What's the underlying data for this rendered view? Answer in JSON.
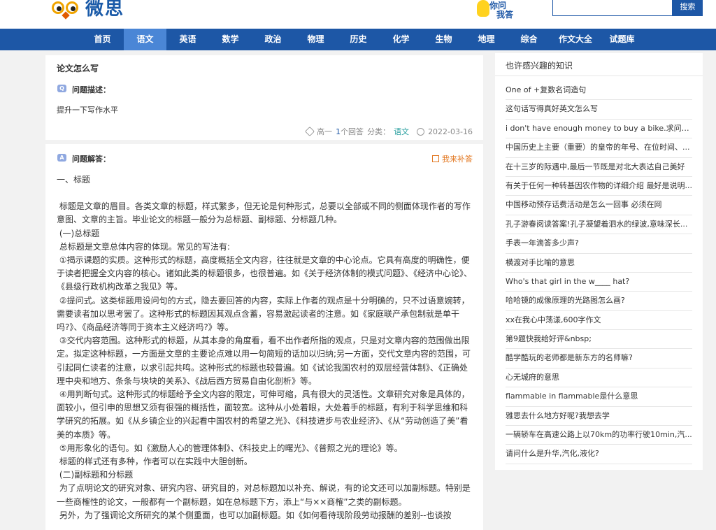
{
  "header": {
    "logo_text": "微思",
    "ask_badge": {
      "line1": "你问",
      "line2": "我答"
    },
    "search": {
      "placeholder": "",
      "button_label": "搜索"
    }
  },
  "nav": {
    "items": [
      "首页",
      "语文",
      "英语",
      "数学",
      "政治",
      "物理",
      "历史",
      "化学",
      "生物",
      "地理",
      "综合",
      "作文大全",
      "试题库"
    ],
    "active": "语文"
  },
  "question": {
    "title": "论文怎么写",
    "desc_tag": "Q",
    "desc_label": "问题描述：",
    "desc": "提升一下写作水平",
    "grade": "高一",
    "answer_count_num": "1",
    "answer_count_suffix": "个回答",
    "category_label": "分类：",
    "category": "语文",
    "date": "2022-03-16"
  },
  "answer": {
    "tag": "A",
    "label": "问题解答：",
    "supplement": "我来补答",
    "paragraphs": [
      "一、标题",
      "",
      " 标题是文章的眉目。各类文章的标题，样式繁多，但无论是何种形式，总要以全部或不同的侧面体现作者的写作意图、文章的主旨。毕业论文的标题一般分为总标题、副标题、分标题几种。",
      " (一)总标题",
      " 总标题是文章总体内容的体现。常见的写法有:",
      " ①揭示课题的实质。这种形式的标题，高度概括全文内容，往往就是文章的中心论点。它具有高度的明确性，便于读者把握全文内容的核心。诸如此类的标题很多，也很普遍。如《关于经济体制的模式问题》、《经济中心论》、《县级行政机构改革之我见》等。",
      " ②提问式。这类标题用设问句的方式，隐去要回答的内容，实际上作者的观点是十分明确的，只不过语意婉转，需要读者加以思考罢了。这种形式的标题因其观点含蓄，容易激起读者的注意。如《家庭联产承包制就是单干吗?》、《商品经济等同于资本主义经济吗?》等。",
      " ③交代内容范围。这种形式的标题，从其本身的角度看，看不出作者所指的观点，只是对文章内容的范围做出限定。拟定这种标题，一方面是文章的主要论点难以用一句简短的话加以归纳;另一方面，交代文章内容的范围，可引起同仁读者的注意，以求引起共鸣。这种形式的标题也较普遍。如《试论我国农村的双层经营体制》、《正确处理中央和地方、条条与块块的关系》、《战后西方贸易自由化剖析》等。",
      " ④用判断句式。这种形式的标题给予全文内容的限定，可伸可缩，具有很大的灵活性。文章研究对象是具体的，面较小，但引申的思想又须有很强的概括性，面较宽。这种从小处着眼，大处着手的标题，有利于科学思维和科学研究的拓展。如《从乡镇企业的兴起看中国农村的希望之光》、《科技进步与农业经济》、《从“劳动创造了美”看美的本质》等。",
      " ⑤用形象化的语句。如《激励人心的管理体制》、《科技史上的曙光》、《普照之光的理论》等。",
      " 标题的样式还有多种，作者可以在实践中大胆创新。",
      " (二)副标题和分标题",
      " 为了点明论文的研究对象、研究内容、研究目的，对总标题加以补充、解说，有的论文还可以加副标题。特别是一些商榷性的论文，一般都有一个副标题，如在总标题下方，添上“与××商榷”之类的副标题。",
      " 另外，为了强调论文所研究的某个侧重面，也可以加副标题。如《如何看待现阶段劳动报酬的差别--也谈按"
    ]
  },
  "sidebar": {
    "title": "也许感兴趣的知识",
    "items": [
      "One of +复数名词造句",
      "这句话写得真好英文怎么写",
      "i don't have enough money to buy a bike.求问句!",
      "中国历史上主要（重要）的皇帝的年号、在位时间、...",
      "在十三岁的际遇中,最后一节既是对北大表达自己美好",
      "有关于任何一种转基因农作物的详细介绍 最好是说明...",
      "中国移动预存话费活动是怎么一回事 必须在网",
      "孔子游春阅读答案!孔子凝望着泗水的绿波,意味深长...",
      "手表一年滴答多少声?",
      "横渡对手比喻的意思",
      "Who's that girl in the w____ hat?",
      "哈哈镜的成像原理的光路图怎么画?",
      "xx在我心中荡漾,600字作文",
      "第9题快我给好评&nbsp;",
      "酷学酷玩的老师都是新东方的名师嘛?",
      "心无城府的意思",
      "flammable in flammable是什么意思",
      "雅思去什么地方好呢?我想去学",
      "一辆轿车在高速公路上以70km的功率行驶10min,汽...",
      "请问什么是升华,汽化,液化?"
    ]
  },
  "colors": {
    "brand": "#1d57a6",
    "nav_active": "#4a86d6",
    "accent": "#e2761e"
  }
}
